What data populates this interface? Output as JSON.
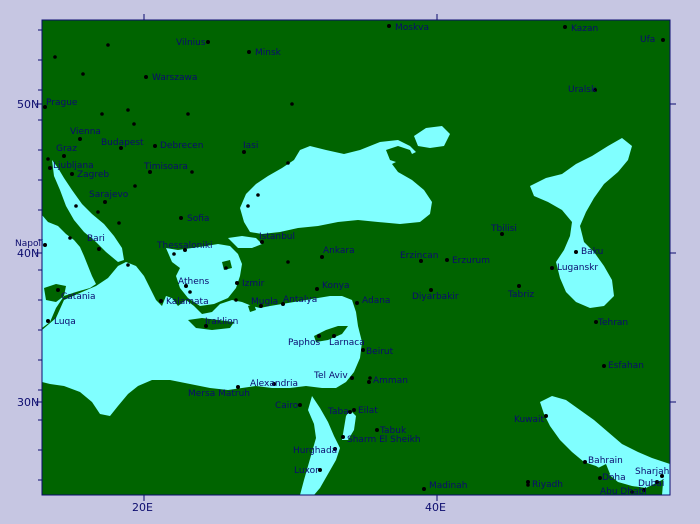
{
  "colors": {
    "frame": "#c6c6e2",
    "land": "#006400",
    "water": "#80ffff",
    "text": "#0b0b6e",
    "marker": "#000000"
  },
  "axes": {
    "lat_labels": [
      "50N",
      "40N",
      "30N"
    ],
    "lon_labels": [
      "20E",
      "40E"
    ]
  },
  "cities": [
    "Moskva",
    "Kazan",
    "Ufa",
    "Vilnius",
    "Minsk",
    "Warszawa",
    "Uralsk",
    "Prague",
    "Vienna",
    "Budapest",
    "Debrecen",
    "Iasi",
    "Graz",
    "Ljubljana",
    "Zagreb",
    "Timisoara",
    "Sarajevo",
    "Sofia",
    "Istanbul",
    "Tbilisi",
    "Napoli",
    "Bari",
    "Thessaloniki",
    "Ankara",
    "Erzincan",
    "Erzurum",
    "Baku",
    "Athens",
    "Izmir",
    "Konya",
    "Diyarbakir",
    "Tabriz",
    "Luganskr",
    "Catania",
    "Kalamata",
    "Mugla",
    "Antalya",
    "Adana",
    "Luqa",
    "Iraklion",
    "Tehran",
    "Paphos",
    "Larnaca",
    "Beirut",
    "Tel Aviv",
    "Amman",
    "Esfahan",
    "Alexandria",
    "Mersa Matruh",
    "Cairo",
    "Taba",
    "Eilat",
    "Kuwait",
    "Tabuk",
    "Sharm El Sheikh",
    "Hurghada",
    "Bahrain",
    "Luxor",
    "Sharjah",
    "Doha",
    "Dubai",
    "Riyadh",
    "Madinah",
    "Abu Dhabi"
  ]
}
